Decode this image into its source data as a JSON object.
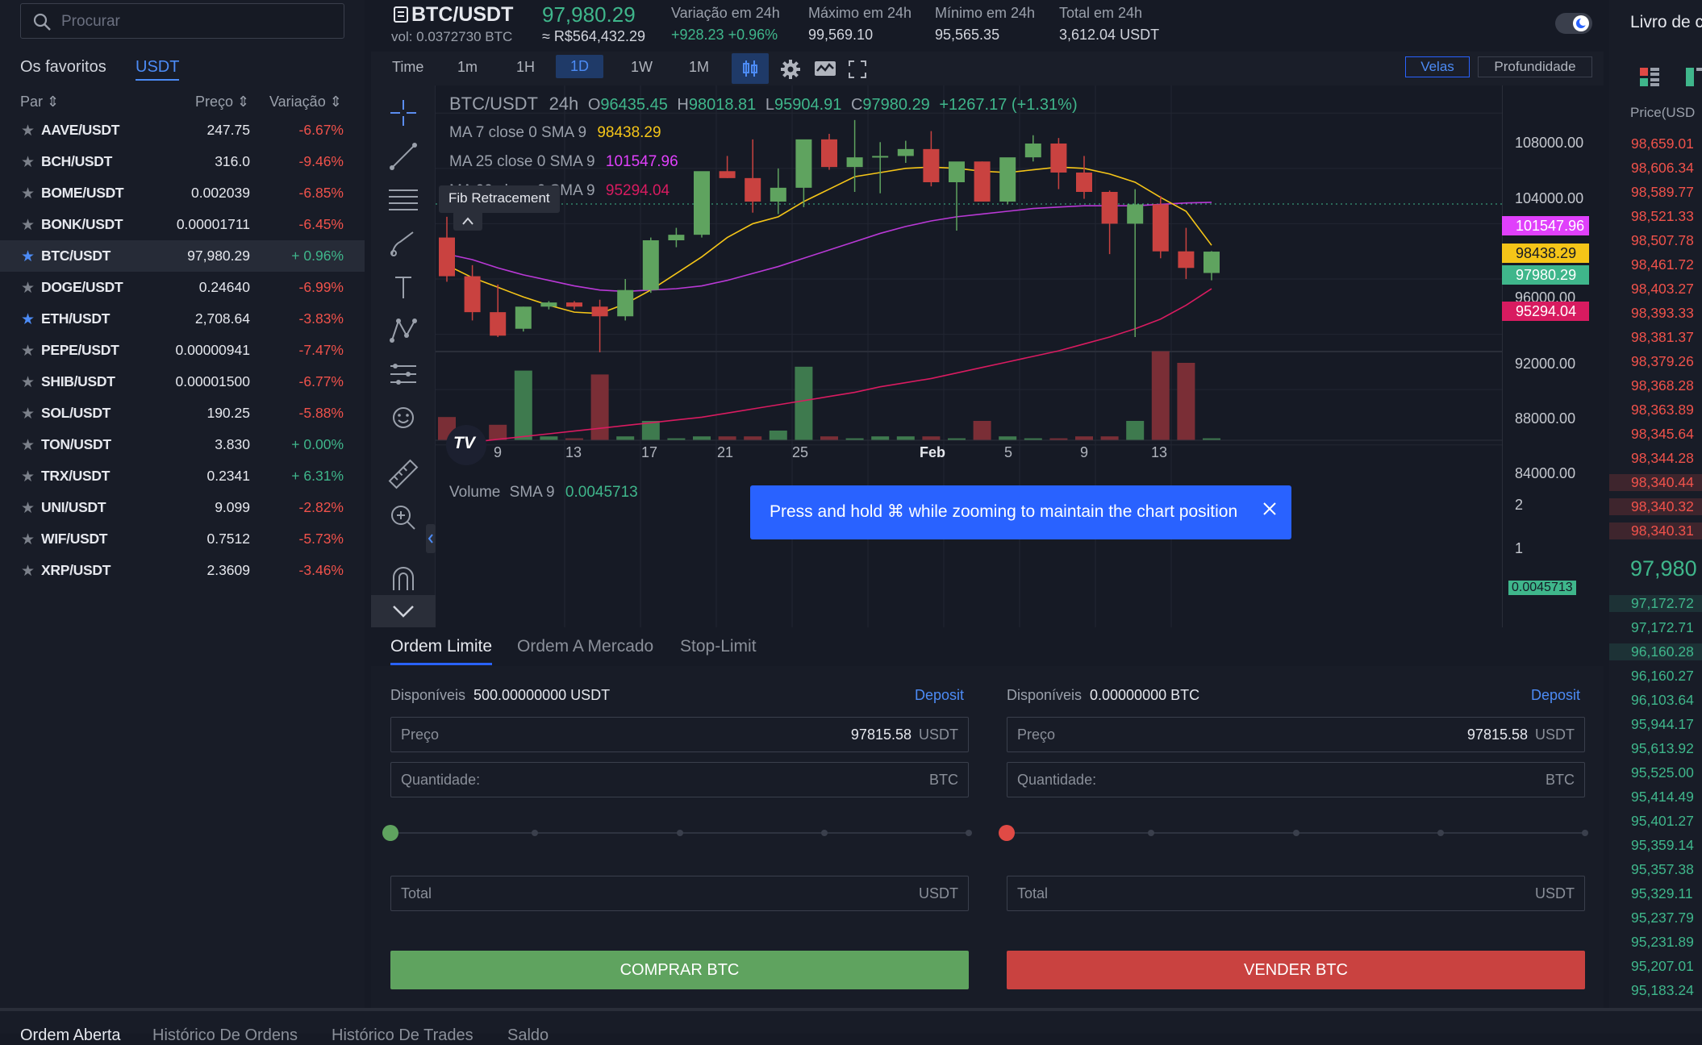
{
  "sidebar": {
    "search_placeholder": "Procurar",
    "tabs": [
      "Os favoritos",
      "USDT"
    ],
    "headers": {
      "pair": "Par",
      "price": "Preço",
      "change": "Variação"
    },
    "rows": [
      {
        "pair": "AAVE/USDT",
        "price": "247.75",
        "change": "-6.67%",
        "fav": false,
        "dir": "neg"
      },
      {
        "pair": "BCH/USDT",
        "price": "316.0",
        "change": "-9.46%",
        "fav": false,
        "dir": "neg"
      },
      {
        "pair": "BOME/USDT",
        "price": "0.002039",
        "change": "-6.85%",
        "fav": false,
        "dir": "neg"
      },
      {
        "pair": "BONK/USDT",
        "price": "0.00001711",
        "change": "-6.45%",
        "fav": false,
        "dir": "neg"
      },
      {
        "pair": "BTC/USDT",
        "price": "97,980.29",
        "change": "+ 0.96%",
        "fav": true,
        "dir": "pos"
      },
      {
        "pair": "DOGE/USDT",
        "price": "0.24640",
        "change": "-6.99%",
        "fav": false,
        "dir": "neg"
      },
      {
        "pair": "ETH/USDT",
        "price": "2,708.64",
        "change": "-3.83%",
        "fav": true,
        "dir": "neg"
      },
      {
        "pair": "PEPE/USDT",
        "price": "0.00000941",
        "change": "-7.47%",
        "fav": false,
        "dir": "neg"
      },
      {
        "pair": "SHIB/USDT",
        "price": "0.00001500",
        "change": "-6.77%",
        "fav": false,
        "dir": "neg"
      },
      {
        "pair": "SOL/USDT",
        "price": "190.25",
        "change": "-5.88%",
        "fav": false,
        "dir": "neg"
      },
      {
        "pair": "TON/USDT",
        "price": "3.830",
        "change": "+ 0.00%",
        "fav": false,
        "dir": "pos"
      },
      {
        "pair": "TRX/USDT",
        "price": "0.2341",
        "change": "+ 6.31%",
        "fav": false,
        "dir": "pos"
      },
      {
        "pair": "UNI/USDT",
        "price": "9.099",
        "change": "-2.82%",
        "fav": false,
        "dir": "neg"
      },
      {
        "pair": "WIF/USDT",
        "price": "0.7512",
        "change": "-5.73%",
        "fav": false,
        "dir": "neg"
      },
      {
        "pair": "XRP/USDT",
        "price": "2.3609",
        "change": "-3.46%",
        "fav": false,
        "dir": "neg"
      }
    ]
  },
  "header": {
    "pair": "BTC/USDT",
    "vol": "vol: 0.0372730 BTC",
    "last_price": "97,980.29",
    "brl": "≈ R$564,432.29",
    "stats": [
      {
        "label": "Variação em 24h",
        "value": "+928.23  +0.96%"
      },
      {
        "label": "Máximo em 24h",
        "value": "99,569.10"
      },
      {
        "label": "Mínimo em 24h",
        "value": "95,565.35"
      },
      {
        "label": "Total em 24h",
        "value": "3,612.04 USDT"
      }
    ]
  },
  "timeframes": [
    "Time",
    "1m",
    "1H",
    "1D",
    "1W",
    "1M"
  ],
  "view_buttons": {
    "candles": "Velas",
    "depth": "Profundidade"
  },
  "chart_legend": {
    "symbol": "BTC/USDT",
    "interval": "24h",
    "o": "96435.45",
    "h": "98018.81",
    "l": "95904.91",
    "c": "97980.29",
    "change": "+1267.17 (+1.31%)",
    "ma7_label": "MA 7 close 0 SMA 9",
    "ma7_value": "98438.29",
    "ma25_label": "MA 25 close 0 SMA 9",
    "ma25_value": "101547.96",
    "ma99_label": "MA 99 close 0 SMA 9",
    "ma99_value": "95294.04",
    "volume_label": "Volume",
    "volume_sma": "SMA 9",
    "volume_value": "0.0045713"
  },
  "tooltip": "Fib Retracement",
  "toast": "Press and hold ⌘ while zooming to maintain the chart position",
  "price_axis": [
    "108000.00",
    "104000.00",
    "96000.00",
    "92000.00",
    "88000.00",
    "84000.00"
  ],
  "price_tags": [
    {
      "text": "101547.96",
      "color": "#e040fb"
    },
    {
      "text": "98438.29",
      "color": "#f5c518"
    },
    {
      "text": "97980.29",
      "color": "#3fb68b"
    },
    {
      "text": "95294.04",
      "color": "#d81b60"
    }
  ],
  "volume_axis": [
    "2",
    "1",
    "0.0045713"
  ],
  "date_axis": [
    "9",
    "13",
    "17",
    "21",
    "25",
    "Feb",
    "5",
    "9",
    "13"
  ],
  "chart_data": {
    "type": "candlestick",
    "ohlc": [
      [
        99000,
        100500,
        95800,
        96200
      ],
      [
        96200,
        97000,
        93000,
        93600
      ],
      [
        93600,
        95600,
        91800,
        91900
      ],
      [
        92400,
        94000,
        92200,
        94000
      ],
      [
        94000,
        94400,
        93800,
        94300
      ],
      [
        94300,
        94400,
        93800,
        94000
      ],
      [
        94000,
        94500,
        90700,
        93300
      ],
      [
        93300,
        96000,
        93000,
        95200
      ],
      [
        95200,
        99000,
        95000,
        98800
      ],
      [
        98800,
        99700,
        98300,
        99200
      ],
      [
        99200,
        102500,
        99000,
        103800
      ],
      [
        103800,
        104900,
        103300,
        103300
      ],
      [
        103300,
        106100,
        100800,
        101600
      ],
      [
        101600,
        104000,
        100700,
        102600
      ],
      [
        102600,
        105600,
        101200,
        106100
      ],
      [
        106100,
        106500,
        103900,
        104100
      ],
      [
        104100,
        107500,
        102300,
        104800
      ],
      [
        104800,
        105900,
        102200,
        104900
      ],
      [
        104900,
        106000,
        104400,
        105400
      ],
      [
        105400,
        106700,
        102700,
        103000
      ],
      [
        103000,
        104300,
        99500,
        104500
      ],
      [
        104500,
        104500,
        101900,
        101600
      ],
      [
        101600,
        104600,
        101400,
        104800
      ],
      [
        104800,
        106400,
        104500,
        105800
      ],
      [
        105800,
        106200,
        102500,
        103700
      ],
      [
        103700,
        104900,
        101800,
        102300
      ],
      [
        102300,
        102400,
        97800,
        100000
      ],
      [
        100000,
        102500,
        91800,
        101400
      ],
      [
        101400,
        102000,
        97500,
        98000
      ],
      [
        98000,
        99700,
        96000,
        96800
      ],
      [
        96435.45,
        98018.81,
        95904.91,
        97980.29
      ]
    ],
    "ma7": [
      97000,
      96100,
      95400,
      94700,
      94100,
      93600,
      93500,
      94200,
      95200,
      96400,
      97600,
      99000,
      100000,
      100500,
      101600,
      102500,
      103400,
      103700,
      104000,
      104100,
      104000,
      103800,
      103700,
      103900,
      104100,
      104000,
      103600,
      103000,
      101900,
      100900,
      98438.29
    ],
    "ma25": [
      97800,
      97400,
      96800,
      96300,
      95900,
      95500,
      95200,
      95100,
      95200,
      95300,
      95500,
      95900,
      96400,
      96900,
      97500,
      98100,
      98700,
      99300,
      99800,
      100200,
      100500,
      100700,
      100900,
      101100,
      101200,
      101300,
      101300,
      101300,
      101400,
      101500,
      101547.96
    ],
    "ma99": [
      84000,
      84200,
      84400,
      84600,
      84800,
      85000,
      85200,
      85400,
      85600,
      85800,
      86000,
      86300,
      86600,
      86900,
      87200,
      87500,
      87800,
      88200,
      88500,
      88800,
      89200,
      89600,
      90000,
      90400,
      90800,
      91300,
      91800,
      92400,
      93100,
      94100,
      95294.04
    ],
    "volume": [
      0.6,
      0.1,
      0.4,
      1.8,
      0.1,
      0.05,
      1.7,
      0.1,
      0.5,
      0.05,
      0.1,
      0.1,
      0.1,
      0.25,
      1.9,
      0.1,
      0.05,
      0.1,
      0.1,
      0.1,
      0.05,
      0.5,
      0.1,
      0.05,
      0.05,
      0.1,
      0.1,
      0.5,
      2.3,
      2.0,
      0.05
    ],
    "ylim": [
      82000,
      110000
    ]
  },
  "form": {
    "tabs": [
      "Ordem Limite",
      "Ordem A Mercado",
      "Stop-Limit"
    ],
    "buy": {
      "available_label": "Disponíveis",
      "available_value": "500.00000000 USDT",
      "deposit": "Deposit",
      "price_label": "Preço",
      "price_value": "97815.58",
      "price_unit": "USDT",
      "qty_label": "Quantidade:",
      "qty_unit": "BTC",
      "total_label": "Total",
      "total_unit": "USDT",
      "button": "COMPRAR BTC"
    },
    "sell": {
      "available_label": "Disponíveis",
      "available_value": "0.00000000 BTC",
      "deposit": "Deposit",
      "price_label": "Preço",
      "price_value": "97815.58",
      "price_unit": "USDT",
      "qty_label": "Quantidade:",
      "qty_unit": "BTC",
      "total_label": "Total",
      "total_unit": "USDT",
      "button": "VENDER BTC"
    }
  },
  "orderbook": {
    "title": "Livro de c",
    "price_header": "Price(USD",
    "asks": [
      "98,659.01",
      "98,606.34",
      "98,589.77",
      "98,521.33",
      "98,507.78",
      "98,461.72",
      "98,403.27",
      "98,393.33",
      "98,381.37",
      "98,379.26",
      "98,368.28",
      "98,363.89",
      "98,345.64",
      "98,344.28",
      "98,340.44",
      "98,340.32",
      "98,340.31"
    ],
    "mid": "97,980",
    "bids": [
      "97,172.72",
      "97,172.71",
      "96,160.28",
      "96,160.27",
      "96,103.64",
      "95,944.17",
      "95,613.92",
      "95,525.00",
      "95,414.49",
      "95,401.27",
      "95,359.14",
      "95,357.38",
      "95,329.11",
      "95,237.79",
      "95,231.89",
      "95,207.01",
      "95,183.24"
    ]
  },
  "bottom_tabs": [
    "Ordem Aberta",
    "Histórico De Ordens",
    "Histórico De Trades",
    "Saldo"
  ]
}
